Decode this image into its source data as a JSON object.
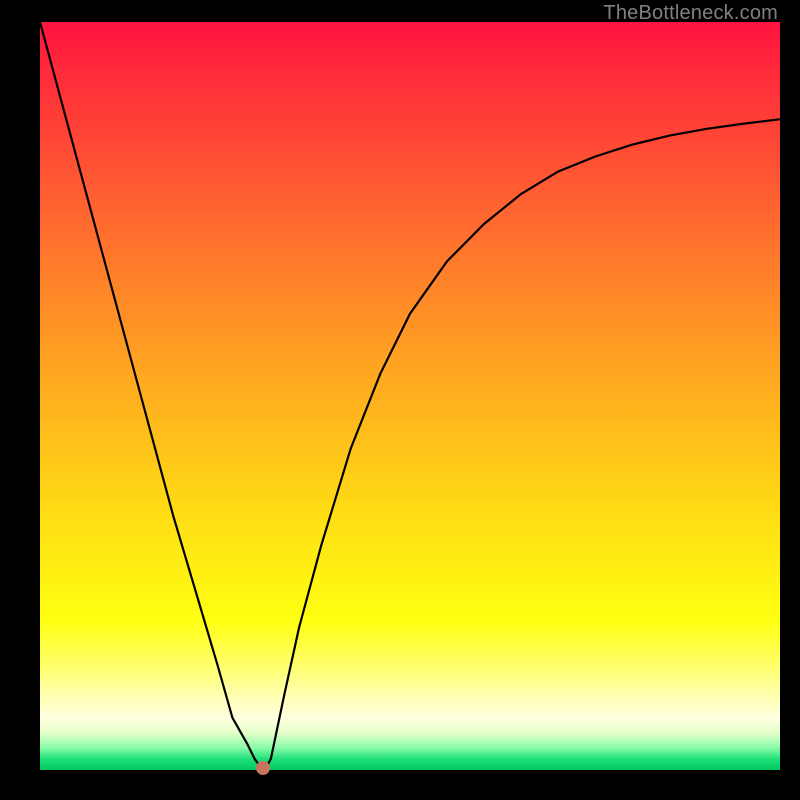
{
  "watermark": "TheBottleneck.com",
  "colors": {
    "frame": "#000000",
    "curve": "#000000",
    "marker": "#c77461",
    "gradient_top": "#ff1340",
    "gradient_bottom": "#00c95f"
  },
  "chart_data": {
    "type": "line",
    "title": "",
    "xlabel": "",
    "ylabel": "",
    "xlim": [
      0,
      1
    ],
    "ylim": [
      0,
      1
    ],
    "x": [
      0.0,
      0.03,
      0.06,
      0.09,
      0.12,
      0.15,
      0.18,
      0.21,
      0.24,
      0.26,
      0.28,
      0.29,
      0.298,
      0.306,
      0.312,
      0.33,
      0.35,
      0.38,
      0.42,
      0.46,
      0.5,
      0.55,
      0.6,
      0.65,
      0.7,
      0.75,
      0.8,
      0.85,
      0.9,
      0.95,
      1.0
    ],
    "y": [
      1.0,
      0.89,
      0.78,
      0.67,
      0.56,
      0.45,
      0.34,
      0.24,
      0.14,
      0.07,
      0.035,
      0.015,
      0.004,
      0.004,
      0.015,
      0.1,
      0.19,
      0.3,
      0.43,
      0.53,
      0.61,
      0.68,
      0.73,
      0.77,
      0.8,
      0.82,
      0.836,
      0.848,
      0.857,
      0.864,
      0.87
    ],
    "marker": {
      "x": 0.302,
      "y": 0.003
    },
    "annotations": []
  }
}
